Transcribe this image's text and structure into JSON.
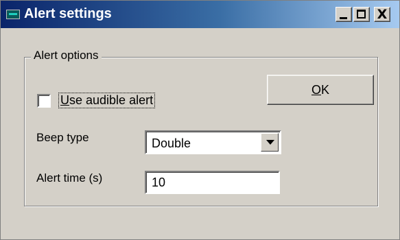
{
  "window": {
    "title": "Alert settings",
    "controls": {
      "minimize_icon": "minimize-icon",
      "maximize_icon": "maximize-icon",
      "close_icon": "close-icon",
      "close_glyph": "X"
    }
  },
  "group": {
    "label": "Alert options"
  },
  "audible_alert": {
    "mnemonic": "U",
    "label_rest": "se audible alert",
    "checked": false
  },
  "ok_button": {
    "mnemonic": "O",
    "label_rest": "K"
  },
  "beep_type": {
    "label": "Beep type",
    "value": "Double"
  },
  "alert_time": {
    "label": "Alert time (s)",
    "value": "10"
  },
  "colors": {
    "titlebar_start": "#0a246a",
    "titlebar_end": "#a6caf0",
    "face": "#d4d0c8"
  }
}
